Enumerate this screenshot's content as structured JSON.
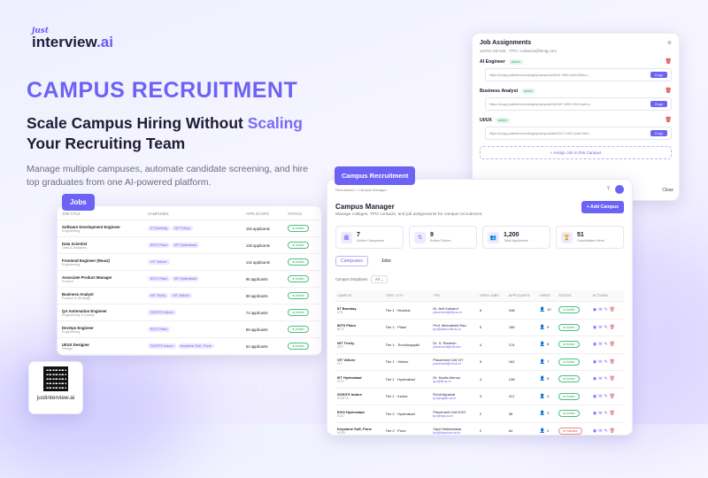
{
  "brand": {
    "logo_prefix": "just",
    "logo_main": "interview",
    "logo_suffix": ".ai"
  },
  "hero": {
    "title": "CAMPUS RECRUITMENT",
    "tagline_a": "Scale Campus Hiring Without ",
    "tagline_hl": "Scaling",
    "tagline_b": " Your Recruiting Team",
    "description": "Manage multiple campuses, automate candidate screening, and hire top graduates from one AI-powered platform."
  },
  "jobs": {
    "tab_label": "Jobs",
    "headers": [
      "JOB TITLE",
      "CAMPUSES",
      "APPLICANTS",
      "STATUS"
    ],
    "rows": [
      {
        "title": "Software Development Engineer",
        "dept": "Engineering",
        "campuses": [
          "IIT Bombay",
          "NIT Trichy"
        ],
        "applicants": "184 applicants",
        "status": "Active"
      },
      {
        "title": "Data Scientist",
        "dept": "Data & Analytics",
        "campuses": [
          "BITS Pilani",
          "IIIT Hyderabad"
        ],
        "applicants": "128 applicants",
        "status": "Active"
      },
      {
        "title": "Frontend Engineer (React)",
        "dept": "Engineering",
        "campuses": [
          "VIT Vellore"
        ],
        "applicants": "142 applicants",
        "status": "Active"
      },
      {
        "title": "Associate Product Manager",
        "dept": "Product",
        "campuses": [
          "BITS Pilani",
          "IIIT Hyderabad"
        ],
        "applicants": "96 applicants",
        "status": "Active"
      },
      {
        "title": "Business Analyst",
        "dept": "Product & Strategy",
        "campuses": [
          "NIT Trichy",
          "VIT Vellore"
        ],
        "applicants": "88 applicants",
        "status": "Active"
      },
      {
        "title": "QA Automation Engineer",
        "dept": "Engineering & Quality",
        "campuses": [
          "SGSITS Indore"
        ],
        "applicants": "74 applicants",
        "status": "Active"
      },
      {
        "title": "DevOps Engineer",
        "dept": "Engineering",
        "campuses": [
          "BITS Pilani"
        ],
        "applicants": "89 applicants",
        "status": "Active"
      },
      {
        "title": "UI/UX Designer",
        "dept": "Design",
        "campuses": [
          "SGSITS Indore",
          "Keystone SoE, Pune"
        ],
        "applicants": "52 applicants",
        "status": "Active"
      }
    ]
  },
  "assign": {
    "title": "Job Assignments",
    "subtitle": "sachin GD test · TPO: codanica@fsnig.com",
    "roles": [
      {
        "name": "AI Engineer",
        "status": "active",
        "link": "https://ai-app.justinterview.ai/apply/campus/a2fe4b-7680-4a44-895a-c...",
        "copy": "Copy"
      },
      {
        "name": "Business Analyst",
        "status": "active",
        "link": "https://ai-app.justinterview.ai/apply/campus/b4a7bd7-3693-4344-aaef-a...",
        "copy": "Copy"
      },
      {
        "name": "UI/UX",
        "status": "active",
        "link": "https://ai-app.justinterview.ai/apply/campus/a6b232c7-2403-4da9-9ebf...",
        "copy": "Copy"
      }
    ],
    "assign_btn": "+ Assign Job to this Campus",
    "close": "Close"
  },
  "campus": {
    "tab_label": "Campus Recruitment",
    "crumb_root": "Recruitment",
    "crumb_sep": ">",
    "crumb_page": "Campus Manager",
    "title": "Campus Manager",
    "subtitle": "Manage colleges, TPO contacts, and job assignments for campus recruitment",
    "add_btn": "+ Add Campus",
    "stats": [
      {
        "num": "7",
        "label": "Active Campuses"
      },
      {
        "num": "9",
        "label": "Active Drives"
      },
      {
        "num": "1,200",
        "label": "Total Applicants"
      },
      {
        "num": "51",
        "label": "Candidates Hired"
      }
    ],
    "tabs": [
      "Campuses",
      "Jobs"
    ],
    "filter_label": "Campus Dropdown:",
    "filter_value": "All",
    "headers": [
      "CAMPUS",
      "TIER / CITY",
      "TPO",
      "OPEN JOBS",
      "APPLICANTS",
      "HIRED",
      "STATUS",
      "ACTIONS"
    ],
    "rows": [
      {
        "name": "IIT Bombay",
        "code": "IITB",
        "tier": "Tier 1 · Mumbai",
        "tpo": "Dr. Anil Kulkarni",
        "mail": "placement@iitb.ac.in",
        "jobs": "6",
        "apps": "248",
        "hired": "12",
        "status": "Active"
      },
      {
        "name": "BITS Pilani",
        "code": "BITS",
        "tier": "Tier 1 · Pilani",
        "tpo": "Prof. Meenakshi Rao",
        "mail": "tpo@pilani.bits.ac.in",
        "jobs": "5",
        "apps": "186",
        "hired": "9",
        "status": "Active"
      },
      {
        "name": "NIT Trichy",
        "code": "NITT",
        "tier": "Tier 1 · Tiruchirappalli",
        "tpo": "Dr. S. Ramesh",
        "mail": "placement@nitt.edu",
        "jobs": "4",
        "apps": "174",
        "hired": "8",
        "status": "Active"
      },
      {
        "name": "VIT Vellore",
        "code": "VIT",
        "tier": "Tier 1 · Vellore",
        "tpo": "Placement Cell VIT",
        "mail": "placement@vit.ac.in",
        "jobs": "5",
        "apps": "162",
        "hired": "7",
        "status": "Active"
      },
      {
        "name": "IIIT Hyderabad",
        "code": "IIITH",
        "tier": "Tier 1 · Hyderabad",
        "tpo": "Dr. Kavita Menon",
        "mail": "tpo@iiit.ac.in",
        "jobs": "4",
        "apps": "138",
        "hired": "6",
        "status": "Active"
      },
      {
        "name": "SGSITS Indore",
        "code": "SGSITS",
        "tier": "Tier 1 · Indore",
        "tpo": "Rohit Agrawal",
        "mail": "tpo@sgsits.ac.in",
        "jobs": "3",
        "apps": "112",
        "hired": "4",
        "status": "Active"
      },
      {
        "name": "EGO Hyderabad",
        "code": "EGO",
        "tier": "Tier 2 · Hyderabad",
        "tpo": "Placement Cell EGO",
        "mail": "tpo@ego.ac.in",
        "jobs": "2",
        "apps": "98",
        "hired": "3",
        "status": "Active"
      },
      {
        "name": "Keystone SoE, Pune",
        "code": "KSOE",
        "tier": "Tier 2 · Pune",
        "tpo": "Vipul Mahindrakar",
        "mail": "tpo@keystone.ac.in",
        "jobs": "2",
        "apps": "64",
        "hired": "2",
        "status": "Inactive"
      }
    ]
  },
  "qr": {
    "label": "justinterview.ai"
  }
}
